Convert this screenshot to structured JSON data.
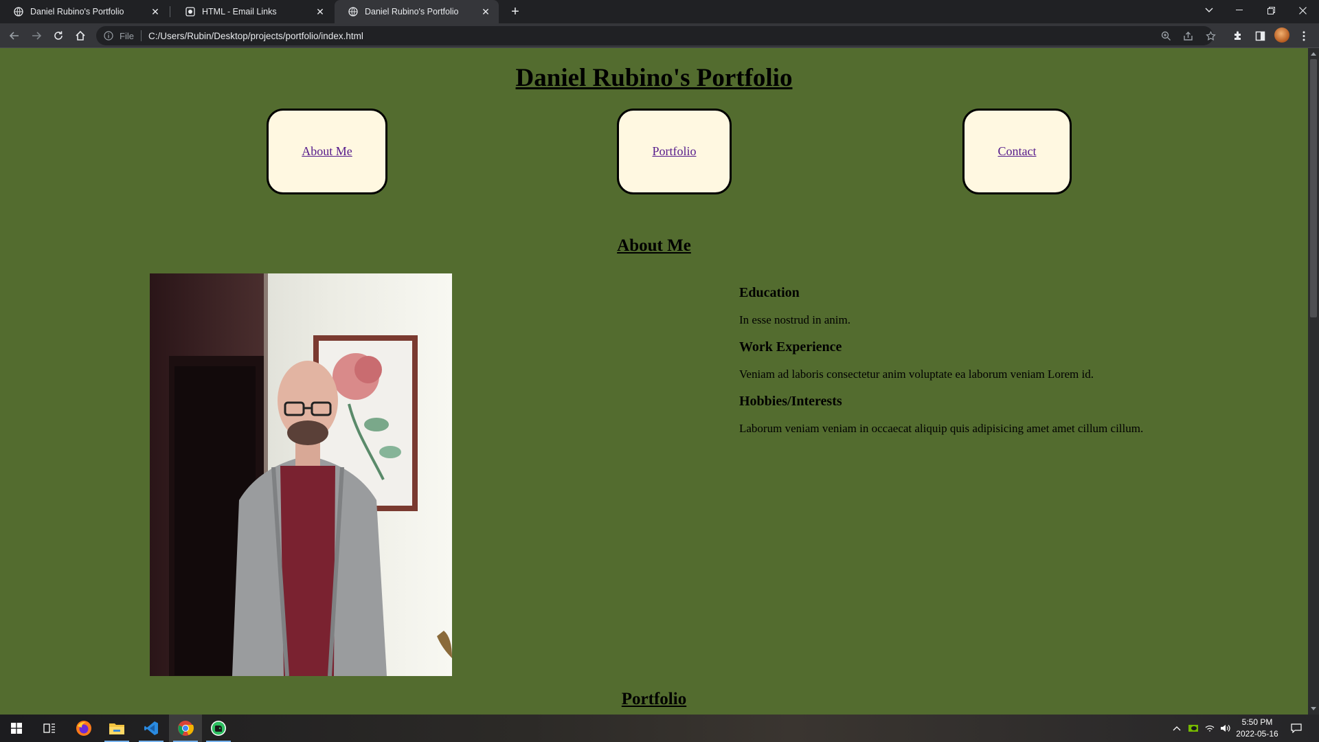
{
  "browser": {
    "tabs": [
      {
        "title": "Daniel Rubino's Portfolio",
        "favicon": "globe-icon",
        "active": false
      },
      {
        "title": "HTML - Email Links",
        "favicon": "site-logo-icon",
        "active": false
      },
      {
        "title": "Daniel Rubino's Portfolio",
        "favicon": "globe-icon",
        "active": true
      }
    ],
    "address": {
      "scheme": "File",
      "url": "C:/Users/Rubin/Desktop/projects/portfolio/index.html"
    }
  },
  "page": {
    "title": "Daniel Rubino's Portfolio",
    "nav": [
      {
        "label": "About Me"
      },
      {
        "label": "Portfolio"
      },
      {
        "label": "Contact"
      }
    ],
    "about": {
      "heading": "About Me",
      "sections": [
        {
          "heading": "Education",
          "text": "In esse nostrud in anim."
        },
        {
          "heading": "Work Experience",
          "text": "Veniam ad laboris consectetur anim voluptate ea laborum veniam Lorem id."
        },
        {
          "heading": "Hobbies/Interests",
          "text": "Laborum veniam veniam in occaecat aliquip quis adipisicing amet amet cillum cillum."
        }
      ]
    },
    "portfolio": {
      "heading": "Portfolio"
    }
  },
  "taskbar": {
    "apps": [
      "windows-start-icon",
      "task-view-icon",
      "firefox-icon",
      "file-explorer-icon",
      "vscode-icon",
      "chrome-icon",
      "evernote-icon"
    ],
    "time": "5:50 PM",
    "date": "2022-05-16"
  },
  "colors": {
    "page_background": "#536c2f",
    "nav_box_background": "#fff8e1",
    "link": "#551a8b"
  }
}
